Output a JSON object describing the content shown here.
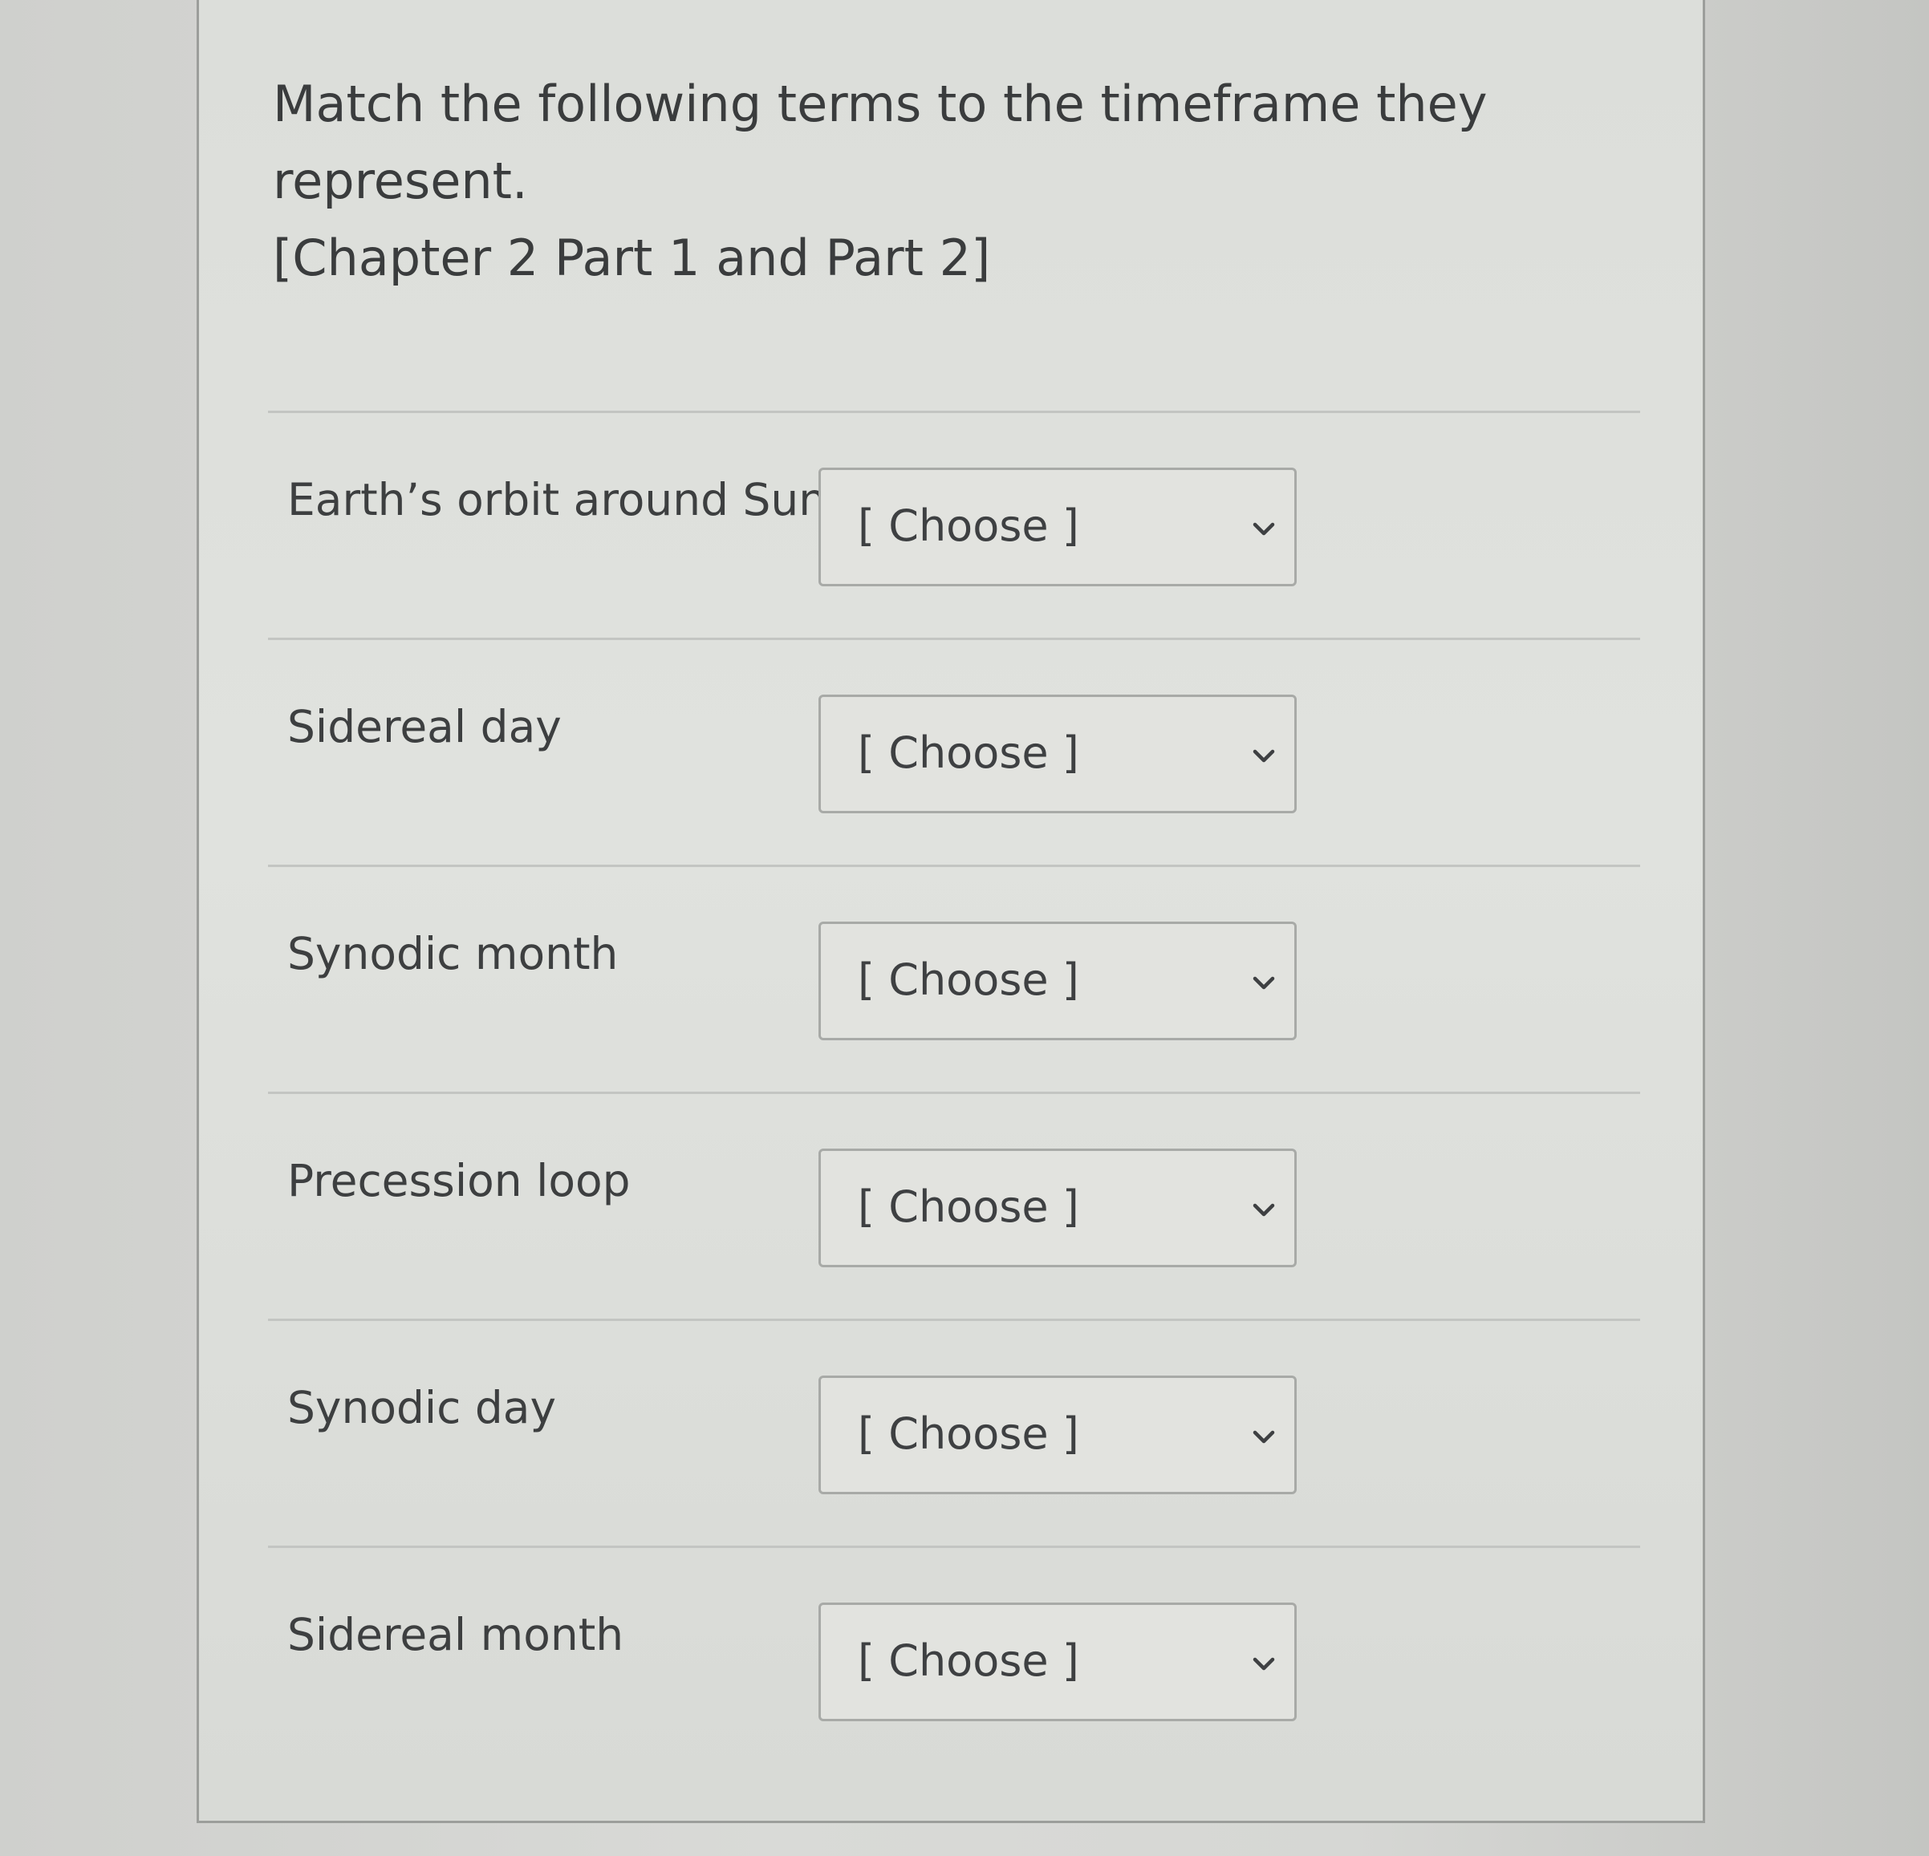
{
  "question": {
    "line1": "Match the following terms to the timeframe they represent.",
    "line2": "[Chapter 2 Part 1 and Part 2]"
  },
  "rows": [
    {
      "term": "Earth’s orbit around Sun",
      "selected": "[ Choose ]"
    },
    {
      "term": "Sidereal day",
      "selected": "[ Choose ]"
    },
    {
      "term": "Synodic month",
      "selected": "[ Choose ]"
    },
    {
      "term": "Precession loop",
      "selected": "[ Choose ]"
    },
    {
      "term": "Synodic day",
      "selected": "[ Choose ]"
    },
    {
      "term": "Sidereal month",
      "selected": "[ Choose ]"
    }
  ],
  "icons": {
    "dropdown": "chevron-down-icon"
  }
}
